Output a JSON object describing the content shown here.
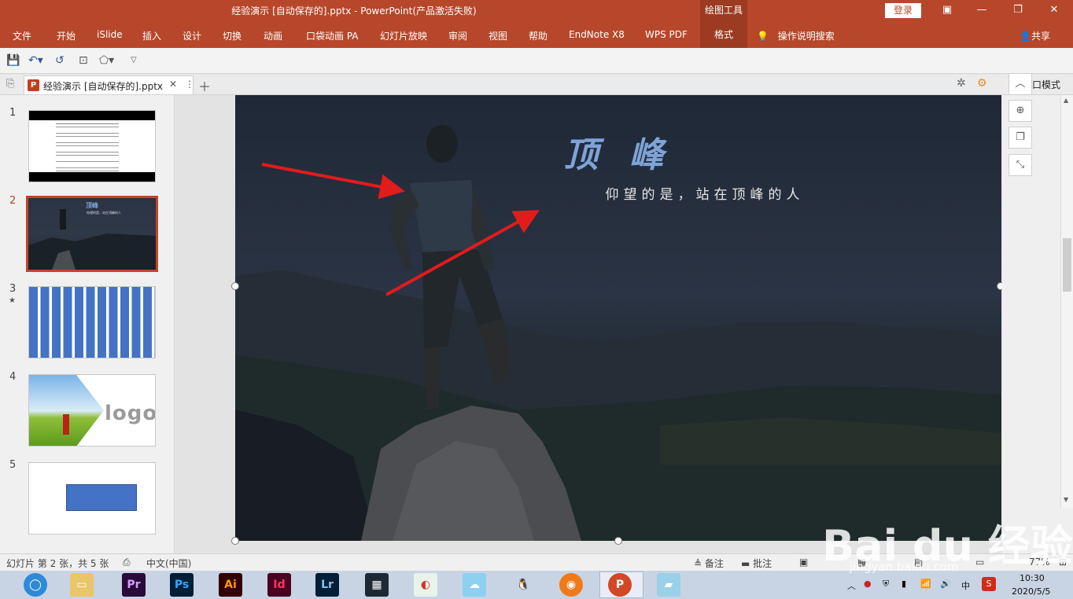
{
  "window": {
    "title": "经验演示 [自动保存的].pptx  -  PowerPoint(产品激活失败)",
    "context_tab_group": "绘图工具",
    "login_label": "登录"
  },
  "ribbon": {
    "tabs": [
      "文件",
      "开始",
      "iSlide",
      "插入",
      "设计",
      "切换",
      "动画",
      "口袋动画 PA",
      "幻灯片放映",
      "审阅",
      "视图",
      "帮助",
      "EndNote X8",
      "WPS PDF",
      "格式"
    ],
    "active_tab": "格式",
    "tell_me": "操作说明搜索",
    "share": "共享"
  },
  "doc_tab": {
    "name": "经验演示 [自动保存的].pptx",
    "badge": "P",
    "window_mode": "窗口模式"
  },
  "thumbnails": [
    {
      "number": "1"
    },
    {
      "number": "2"
    },
    {
      "number": "3",
      "star": "★"
    },
    {
      "number": "4",
      "logo_text": "logo"
    },
    {
      "number": "5"
    }
  ],
  "slide": {
    "title": "顶 峰",
    "subtitle": "仰望的是，站在顶峰的人",
    "thumb_title": "顶峰",
    "thumb_subtitle": "仰望的是，站在顶峰的人"
  },
  "status": {
    "slide_info": "幻灯片 第 2 张，共 5 张",
    "language": "中文(中国)",
    "notes": "备注",
    "comments": "批注",
    "zoom": "77%"
  },
  "taskbar": {
    "apps": [
      "Pr",
      "Ps",
      "Ai",
      "Id",
      "Lr"
    ],
    "tray_ime": "中",
    "time": "10:30",
    "date": "2020/5/5"
  },
  "watermark": {
    "brand": "Bai du 经验",
    "url": "jingyan.baidu.com"
  },
  "colors": {
    "accent": "#b7472a",
    "accent_dark": "#9c3b21",
    "slide_title": "#7fa3d8",
    "arrow": "#e21b1b"
  }
}
